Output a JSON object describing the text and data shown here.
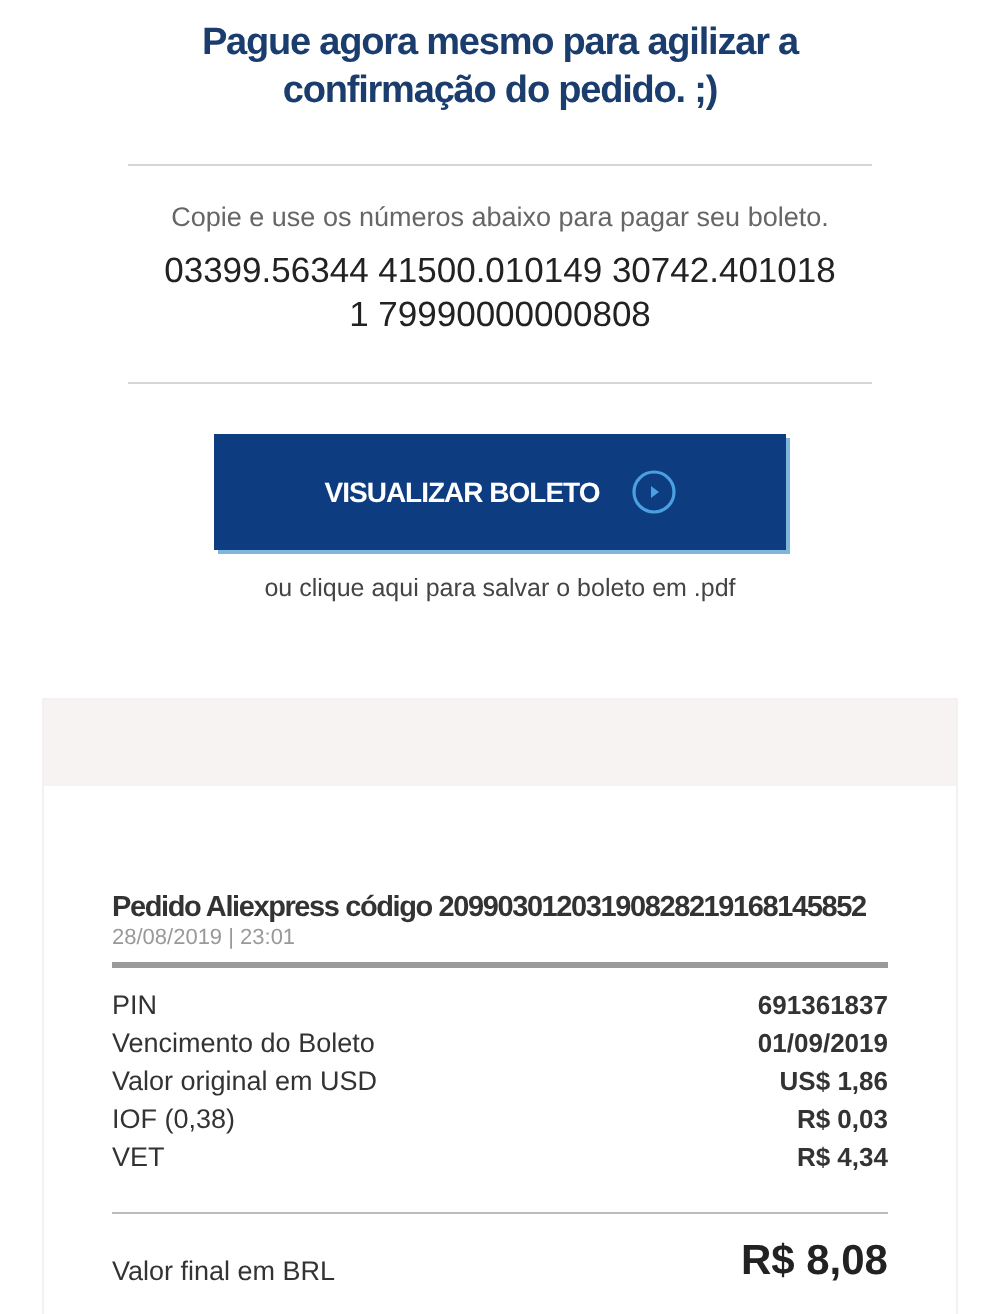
{
  "heading": "Pague agora mesmo para agilizar a confirmação do pedido. ;)",
  "instruction": "Copie e use os números abaixo para pagar seu boleto.",
  "barcode_lines": [
    "03399.56344 41500.010149 30742.401018",
    "1 79990000000808"
  ],
  "view_button": {
    "label": "VISUALIZAR BOLETO"
  },
  "pdf_link": "ou clique aqui para salvar o boleto em .pdf",
  "order": {
    "title": "Pedido Aliexpress código 20990301203190828219168145852",
    "date": "28/08/2019 | 23:01",
    "rows": [
      {
        "label": "PIN",
        "value": "691361837"
      },
      {
        "label": "Vencimento do Boleto",
        "value": "01/09/2019"
      },
      {
        "label": "Valor original em USD",
        "value": "US$ 1,86"
      },
      {
        "label": "IOF (0,38)",
        "value": "R$ 0,03"
      },
      {
        "label": "VET",
        "value": "R$ 4,34"
      }
    ],
    "total": {
      "label": "Valor final em BRL",
      "value": "R$ 8,08"
    }
  }
}
